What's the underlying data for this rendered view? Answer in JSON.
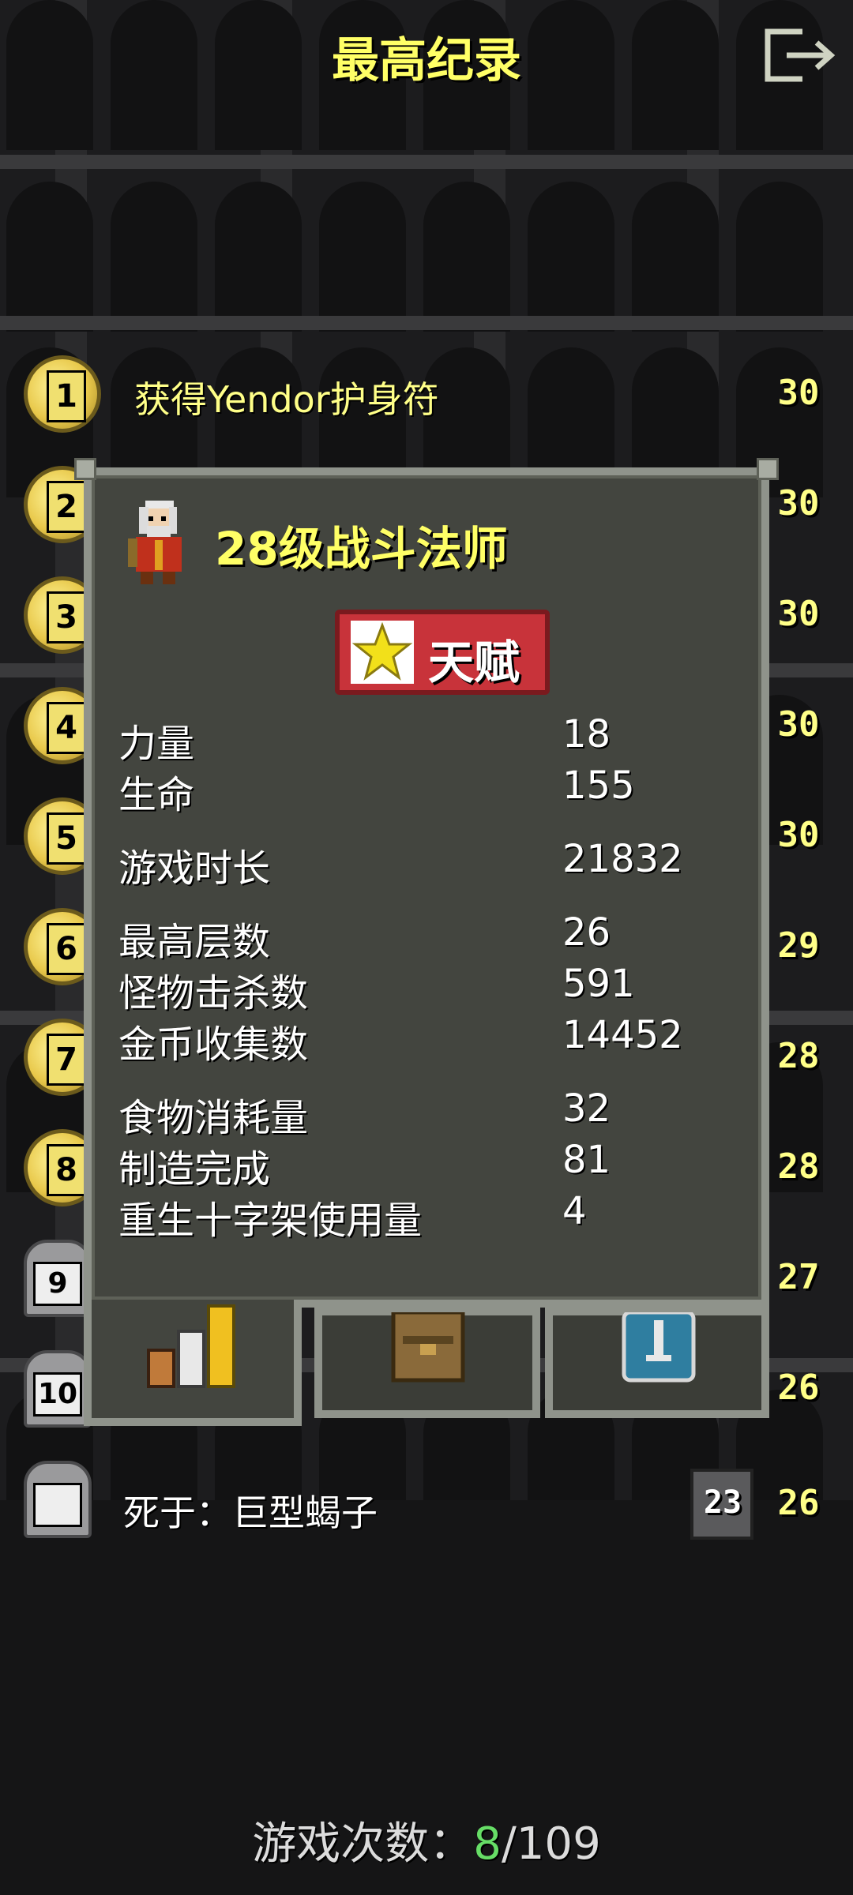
{
  "header": {
    "title": "最高纪录",
    "exit_icon": "exit-icon"
  },
  "records": [
    {
      "rank": "1",
      "text": "获得Yendor护身符",
      "level": "30",
      "type": "medal"
    },
    {
      "rank": "2",
      "level": "30",
      "type": "medal"
    },
    {
      "rank": "3",
      "level": "30",
      "type": "medal"
    },
    {
      "rank": "4",
      "level": "30",
      "type": "medal"
    },
    {
      "rank": "5",
      "level": "30",
      "type": "medal"
    },
    {
      "rank": "6",
      "level": "29",
      "type": "medal"
    },
    {
      "rank": "7",
      "level": "28",
      "type": "medal"
    },
    {
      "rank": "8",
      "level": "28",
      "type": "medal"
    },
    {
      "rank": "9",
      "level": "27",
      "type": "tomb"
    },
    {
      "rank": "10",
      "level": "26",
      "type": "tomb"
    },
    {
      "rank": "",
      "text": "死于：巨型蝎子",
      "depth": "23",
      "level": "26",
      "type": "tomb"
    }
  ],
  "modal": {
    "hero_title": "28级战斗法师",
    "talent_button": "天赋",
    "stats": [
      {
        "label": "力量",
        "value": "18"
      },
      {
        "label": "生命",
        "value": "155"
      },
      {
        "label": "游戏时长",
        "value": "21832"
      },
      {
        "label": "最高层数",
        "value": "26"
      },
      {
        "label": "怪物击杀数",
        "value": "591"
      },
      {
        "label": "金币收集数",
        "value": "14452"
      },
      {
        "label": "食物消耗量",
        "value": "32"
      },
      {
        "label": "制造完成",
        "value": "81"
      },
      {
        "label": "重生十字架使用量",
        "value": "4"
      }
    ],
    "tabs": [
      {
        "icon": "stats-bars-icon",
        "active": true
      },
      {
        "icon": "backpack-icon",
        "active": false
      },
      {
        "icon": "badge-shield-icon",
        "active": false
      }
    ]
  },
  "footer": {
    "games_label": "游戏次数：",
    "games_current": "8",
    "games_total": "/109"
  },
  "colors": {
    "title_yellow": "#ffff66",
    "talent_red": "#c8333a",
    "modal_bg": "#43453f",
    "modal_border": "#8f938b",
    "count_green": "#66dd66"
  }
}
